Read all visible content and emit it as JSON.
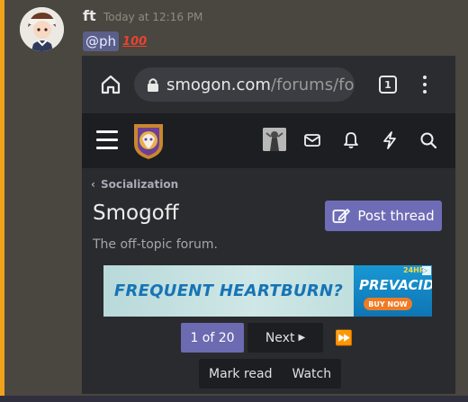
{
  "message": {
    "username": "ft",
    "timestamp": "Today at 12:16 PM",
    "mention": "@ph",
    "emoji_text": "100"
  },
  "browser": {
    "url_host": "smogon.com",
    "url_path": "/forums/fo",
    "tab_count": "1"
  },
  "forum": {
    "breadcrumb": "Socialization",
    "title": "Smogoff",
    "description": "The off-topic forum.",
    "post_thread_label": "Post thread"
  },
  "ad": {
    "headline": "FREQUENT HEARTBURN?",
    "brand": "PREVACID",
    "badge": "24HR",
    "cta": "BUY NOW"
  },
  "pagination": {
    "current": "1 of 20",
    "next_label": "Next"
  },
  "actions": {
    "mark_read": "Mark read",
    "watch": "Watch"
  },
  "colors": {
    "accent_bar": "#f0a21b",
    "button_primary": "#6e6cb6",
    "header_bg": "#1d1e22"
  }
}
